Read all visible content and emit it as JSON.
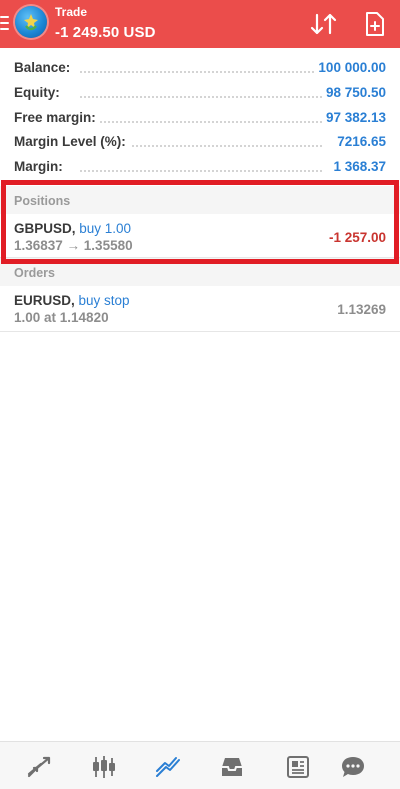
{
  "header": {
    "title": "Trade",
    "profit": "-1 249.50 USD"
  },
  "summary": [
    {
      "label": "Balance:",
      "value": "100 000.00"
    },
    {
      "label": "Equity:",
      "value": "98 750.50"
    },
    {
      "label": "Free margin:",
      "value": "97 382.13"
    },
    {
      "label": "Margin Level (%):",
      "value": "7216.65"
    },
    {
      "label": "Margin:",
      "value": "1 368.37"
    }
  ],
  "positions": {
    "title": "Positions",
    "items": [
      {
        "symbol": "GBPUSD,",
        "side": " buy 1.00",
        "prices": "1.36837 → 1.35580",
        "profit": "-1 257.00"
      }
    ]
  },
  "orders": {
    "title": "Orders",
    "items": [
      {
        "symbol": "EURUSD,",
        "side": " buy stop",
        "details": "1.00 at 1.14820",
        "price": "1.13269"
      }
    ]
  },
  "colors": {
    "header": "#eb4d4b",
    "accent": "#2a7fd4",
    "loss": "#c9342f",
    "highlight": "#e11d25"
  },
  "icons": [
    "menu-icon",
    "app-logo-icon",
    "sort-icon",
    "new-order-icon",
    "quotes-icon",
    "chart-icon",
    "trade-icon",
    "history-icon",
    "news-icon",
    "messages-icon"
  ]
}
